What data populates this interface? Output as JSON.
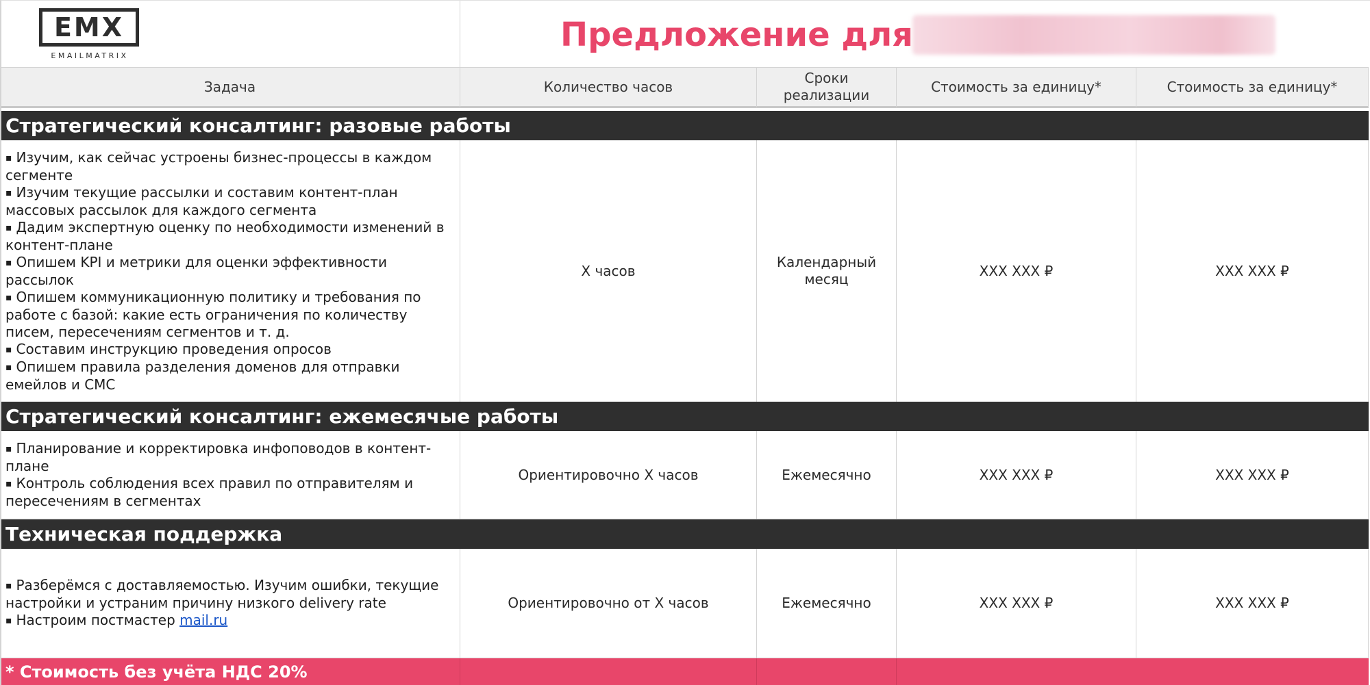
{
  "logo": {
    "mark": "EMX",
    "wordmark": "EMAILMATRIX"
  },
  "title": "Предложение для",
  "columns": [
    "Задача",
    "Количество часов",
    "Сроки\nреализации",
    "Стоимость за единицу*",
    "Стоимость за единицу*"
  ],
  "sections": [
    {
      "title": "Стратегический консалтинг: разовые работы",
      "tasks": [
        "Изучим, как сейчас устроены бизнес-процессы в каждом сегменте",
        "Изучим текущие рассылки и составим контент-план массовых рассылок для каждого сегмента",
        "Дадим экспертную оценку по необходимости изменений в контент-плане",
        "Опишем  KPI и метрики для оценки эффективности рассылок",
        "Опишем коммуникационную политику и требования по работе с базой: какие есть ограничения по количеству писем, пересечениям сегментов и т. д.",
        "Составим инструкцию проведения опросов",
        "Опишем правила разделения доменов для отправки емейлов и СМС"
      ],
      "hours": "X часов",
      "timing": "Календарный месяц",
      "price1": "XXX XXX ₽",
      "price2": "XXX XXX ₽"
    },
    {
      "title": "Стратегический консалтинг: ежемесячые работы",
      "tasks": [
        "Планирование и корректировка инфоповодов в контент-плане",
        "Контроль соблюдения всех правил по отправителям и пересечениям в сегментах"
      ],
      "hours": "Ориентировочно X часов",
      "timing": "Ежемесячно",
      "price1": "XXX XXX ₽",
      "price2": "XXX XXX ₽"
    },
    {
      "title": "Техническая поддержка",
      "tasks": [
        "Разберёмся с доставляемостью. Изучим ошибки, текущие настройки и устраним причину низкого delivery rate",
        "Настроим постмастер "
      ],
      "task_link": "mail.ru",
      "hours": "Ориентировочно от X часов",
      "timing": "Ежемесячно",
      "price1": "XXX XXX ₽",
      "price2": "XXX XXX ₽"
    }
  ],
  "bullet_glyph": "▪",
  "footnote": "* Стоимость без учёта НДС 20%",
  "colors": {
    "accent": "#e8466a",
    "section_bg": "#2f2f2f",
    "header_bg": "#efefef"
  }
}
